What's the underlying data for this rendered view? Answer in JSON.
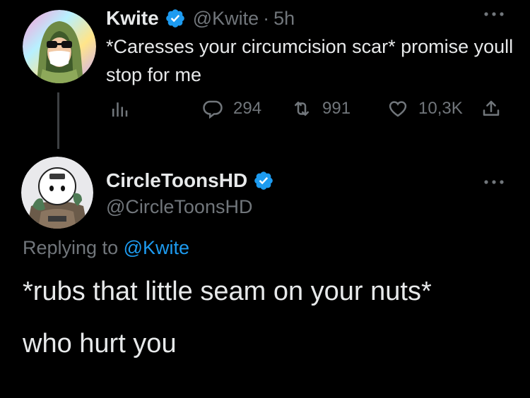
{
  "parent_tweet": {
    "display_name": "Kwite",
    "handle": "@Kwite",
    "separator": "·",
    "time": "5h",
    "text": "*Caresses your circumcision scar* promise youll stop for me",
    "stats": {
      "replies": "294",
      "retweets": "991",
      "likes": "10,3K"
    }
  },
  "reply_tweet": {
    "display_name": "CircleToonsHD",
    "handle": "@CircleToonsHD",
    "replying_prefix": "Replying to",
    "replying_mention": "@Kwite",
    "text_line1": "*rubs that little seam on your nuts*",
    "text_line2": "who hurt you"
  },
  "colors": {
    "background": "#000000",
    "text_primary": "#e7e9ea",
    "text_secondary": "#71767b",
    "accent": "#1d9bf0",
    "verified": "#1d9bf0"
  }
}
